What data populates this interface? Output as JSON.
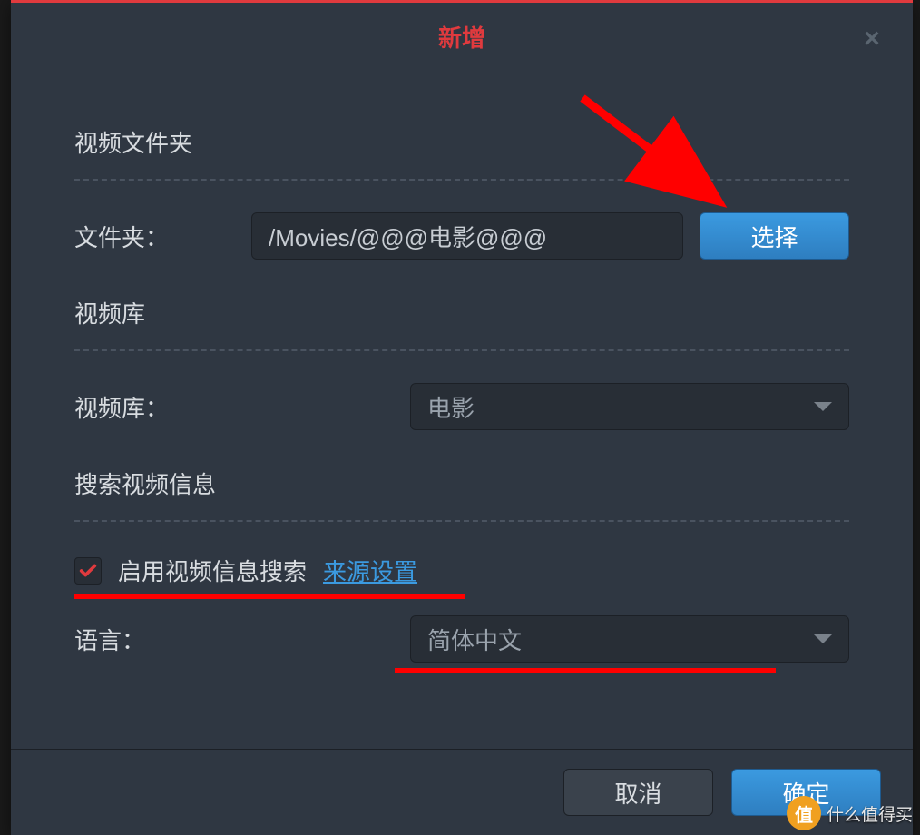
{
  "dialog": {
    "title": "新增",
    "close_label": "×"
  },
  "sections": {
    "video_folder": "视频文件夹",
    "video_library": "视频库",
    "search_info": "搜索视频信息"
  },
  "folder": {
    "label": "文件夹：",
    "value": "/Movies/@@@电影@@@",
    "select_button": "选择"
  },
  "library": {
    "label": "视频库：",
    "selected": "电影"
  },
  "search": {
    "checkbox_label": "启用视频信息搜索",
    "source_link": "来源设置",
    "checked": true
  },
  "language": {
    "label": "语言：",
    "selected": "简体中文"
  },
  "footer": {
    "cancel": "取消",
    "ok": "确定"
  },
  "watermark": {
    "badge": "值",
    "text": "什么值得买"
  }
}
